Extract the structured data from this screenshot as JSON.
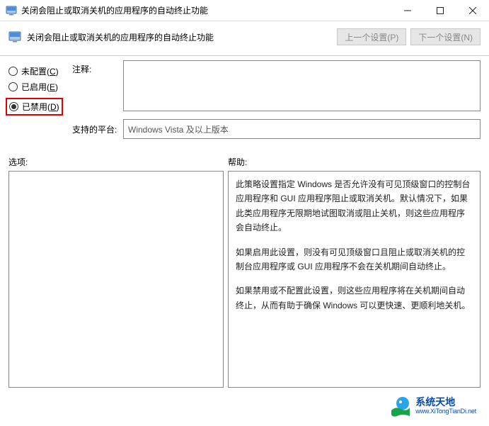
{
  "window": {
    "title": "关闭会阻止或取消关机的应用程序的自动终止功能"
  },
  "header": {
    "title": "关闭会阻止或取消关机的应用程序的自动终止功能",
    "prev_btn": "上一个设置(P)",
    "next_btn": "下一个设置(N)"
  },
  "radios": {
    "not_configured": {
      "label": "未配置(",
      "accel": "C",
      "suffix": ")"
    },
    "enabled": {
      "label": "已启用(",
      "accel": "E",
      "suffix": ")"
    },
    "disabled": {
      "label": "已禁用(",
      "accel": "D",
      "suffix": ")"
    }
  },
  "labels": {
    "comment": "注释:",
    "platform": "支持的平台:",
    "options": "选项:",
    "help": "帮助:"
  },
  "fields": {
    "comment_value": "",
    "platform_value": "Windows Vista 及以上版本"
  },
  "help": {
    "p1": "此策略设置指定 Windows 是否允许没有可见顶级窗口的控制台应用程序和 GUI 应用程序阻止或取消关机。默认情况下，如果此类应用程序无限期地试图取消或阻止关机，则这些应用程序会自动终止。",
    "p2": "如果启用此设置，则没有可见顶级窗口且阻止或取消关机的控制台应用程序或 GUI 应用程序不会在关机期间自动终止。",
    "p3": "如果禁用或不配置此设置，则这些应用程序将在关机期间自动终止，从而有助于确保 Windows 可以更快速、更顺利地关机。"
  },
  "watermark": {
    "cn": "系统天地",
    "en": "www.XiTongTianDi.net"
  }
}
